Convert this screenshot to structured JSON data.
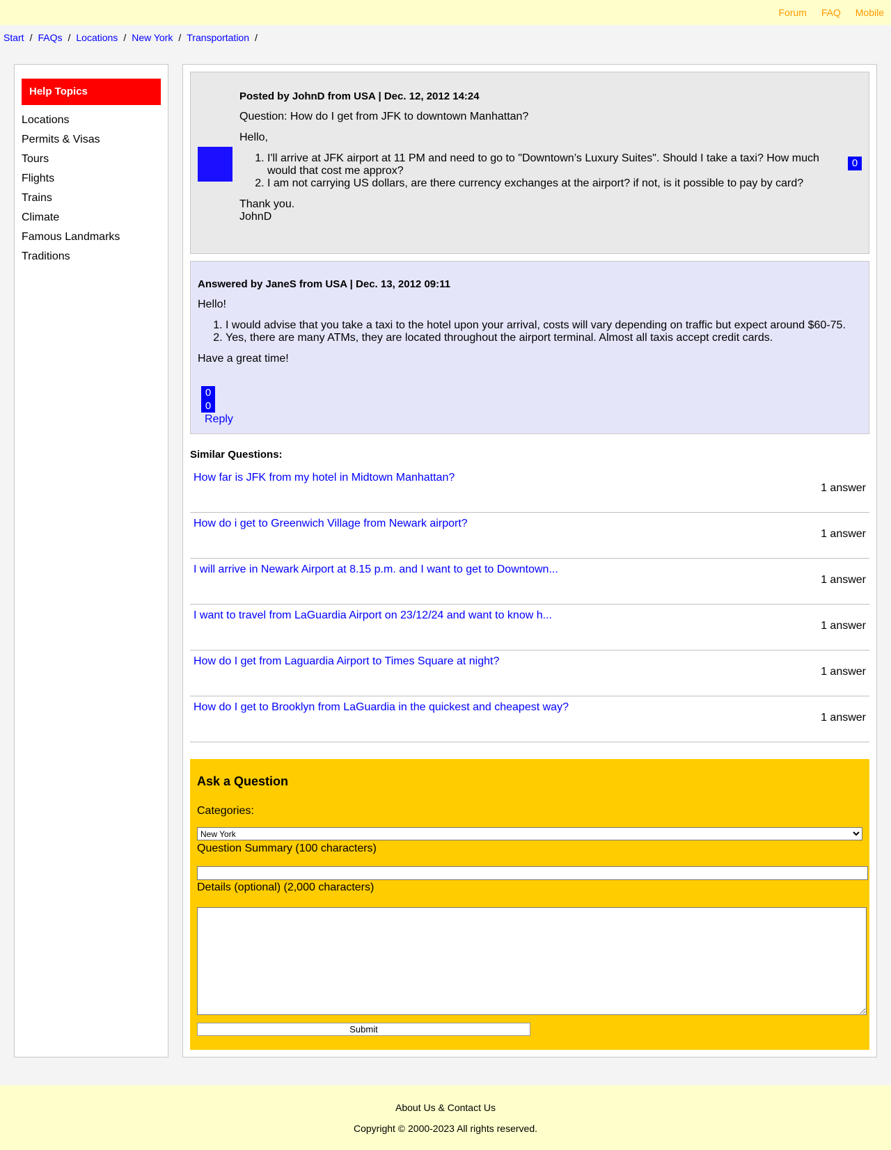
{
  "topnav": {
    "links": [
      "Forum",
      "FAQ",
      "Mobile"
    ]
  },
  "breadcrumb": [
    "Start",
    "FAQs",
    "Locations",
    "New York",
    "Transportation"
  ],
  "breadcrumb_sep": "/",
  "sidebar": {
    "title": "Help Topics",
    "items": [
      "Locations",
      "Permits & Visas",
      "Tours",
      "Flights",
      "Trains",
      "Climate",
      "Famous Landmarks",
      "Traditions"
    ]
  },
  "question": {
    "meta": "Posted by JohnD from USA | Dec. 12, 2012 14:24",
    "title": "Question: How do I get from JFK to downtown Manhattan?",
    "greeting": "Hello,",
    "points": [
      "I'll arrive at JFK airport at 11 PM and need to go to \"Downtown’s Luxury Suites\". Should I take a taxi? How much would that cost me approx?",
      "I am not carrying US dollars, are there currency exchanges at the airport? if not, is it possible to pay by card?"
    ],
    "closing": "Thank you.",
    "signature": "JohnD",
    "votes": "0"
  },
  "answer": {
    "meta": "Answered by JaneS from USA | Dec. 13, 2012 09:11",
    "greeting": "Hello!",
    "points": [
      "I would advise that you take a taxi to the hotel upon your arrival, costs will vary depending on traffic but expect around $60-75.",
      "Yes, there are many ATMs, they are located throughout the airport terminal. Almost all taxis accept credit cards."
    ],
    "closing": "Have a great time!",
    "votes_up": "0",
    "votes_down": "0",
    "reply": "Reply"
  },
  "similar": {
    "title": "Similar Questions:",
    "items": [
      {
        "q": "How far is JFK from my hotel in Midtown Manhattan?",
        "count": "1 answer"
      },
      {
        "q": "How do i get to Greenwich Village from Newark airport?",
        "count": "1 answer"
      },
      {
        "q": "I will arrive in Newark Airport at 8.15 p.m. and I want to get to Downtown...",
        "count": "1 answer"
      },
      {
        "q": "I want to travel from LaGuardia Airport on 23/12/24 and want to know h...",
        "count": "1 answer"
      },
      {
        "q": "How do I get from Laguardia Airport to Times Square at night?",
        "count": "1 answer"
      },
      {
        "q": "How do I get to Brooklyn from LaGuardia in the quickest and cheapest way?",
        "count": "1 answer"
      }
    ]
  },
  "ask": {
    "title": "Ask a Question",
    "categories_label": "Categories:",
    "category_selected": "New York",
    "summary_label": "Question Summary (100 characters)",
    "summary_value": "",
    "details_label": "Details (optional) (2,000 characters)",
    "details_value": "",
    "submit": "Submit"
  },
  "footer": {
    "about": "About Us & Contact Us",
    "copyright": "Copyright © 2000-2023 All rights reserved."
  },
  "colors": {
    "topbar_bg": "#ffffcc",
    "nav_link": "#ff9900",
    "link": "#0000ff",
    "help_header": "#ff0000",
    "post_bg": "#e9e9e9",
    "answer_bg": "#e5e5fa",
    "ask_bg": "#ffcc00",
    "avatar": "#1a0fff"
  }
}
